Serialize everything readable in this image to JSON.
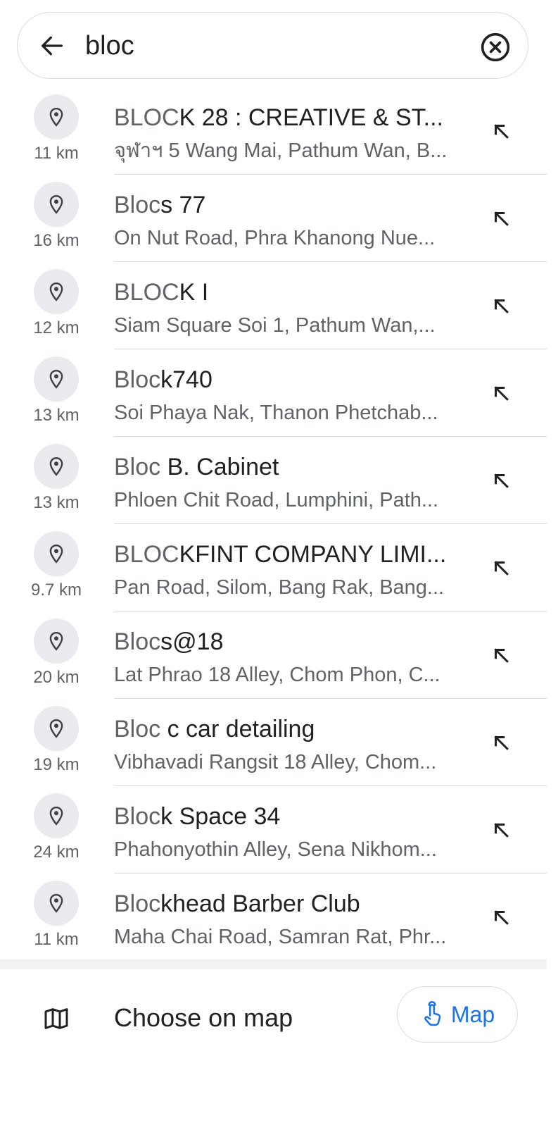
{
  "search": {
    "query": "bloc"
  },
  "results": [
    {
      "match": "BLOC",
      "rest": "K 28 : CREATIVE & ST...",
      "address": "จุฬาฯ 5 Wang Mai, Pathum Wan, B...",
      "distance": "11 km"
    },
    {
      "match": "Bloc",
      "rest": "s 77",
      "address": "On Nut Road, Phra Khanong Nue...",
      "distance": "16 km"
    },
    {
      "match": "BLOC",
      "rest": "K I",
      "address": "Siam Square Soi 1, Pathum Wan,...",
      "distance": "12 km"
    },
    {
      "match": "Bloc",
      "rest": "k740",
      "address": "Soi Phaya Nak, Thanon Phetchab...",
      "distance": "13 km"
    },
    {
      "match": "Bloc",
      "rest": " B. Cabinet",
      "address": "Phloen Chit Road, Lumphini, Path...",
      "distance": "13 km"
    },
    {
      "match": "BLOC",
      "rest": "KFINT COMPANY LIMI...",
      "address": "Pan Road, Silom, Bang Rak, Bang...",
      "distance": "9.7 km"
    },
    {
      "match": "Bloc",
      "rest": "s@18",
      "address": "Lat Phrao 18 Alley, Chom Phon, C...",
      "distance": "20 km"
    },
    {
      "match": "Bloc",
      "rest": " c car detailing",
      "address": "Vibhavadi Rangsit 18 Alley, Chom...",
      "distance": "19 km"
    },
    {
      "match": "Bloc",
      "rest": "k Space 34",
      "address": "Phahonyothin Alley, Sena Nikhom...",
      "distance": "24 km"
    },
    {
      "match": "Bloc",
      "rest": "khead Barber Club",
      "address": "Maha Chai Road, Samran Rat, Phr...",
      "distance": "11 km"
    }
  ],
  "bottom": {
    "choose_on_map": "Choose on map",
    "map_button": "Map"
  },
  "icons": {
    "back": "arrow-back-icon",
    "clear": "clear-circle-icon",
    "pin": "location-pin-icon",
    "fill_query": "arrow-up-left-icon",
    "map": "folded-map-icon",
    "touch": "touch-gesture-icon"
  },
  "colors": {
    "accent": "#1a73e8",
    "secondary_text": "#5f6368",
    "pin_bg": "#e8eaed"
  }
}
